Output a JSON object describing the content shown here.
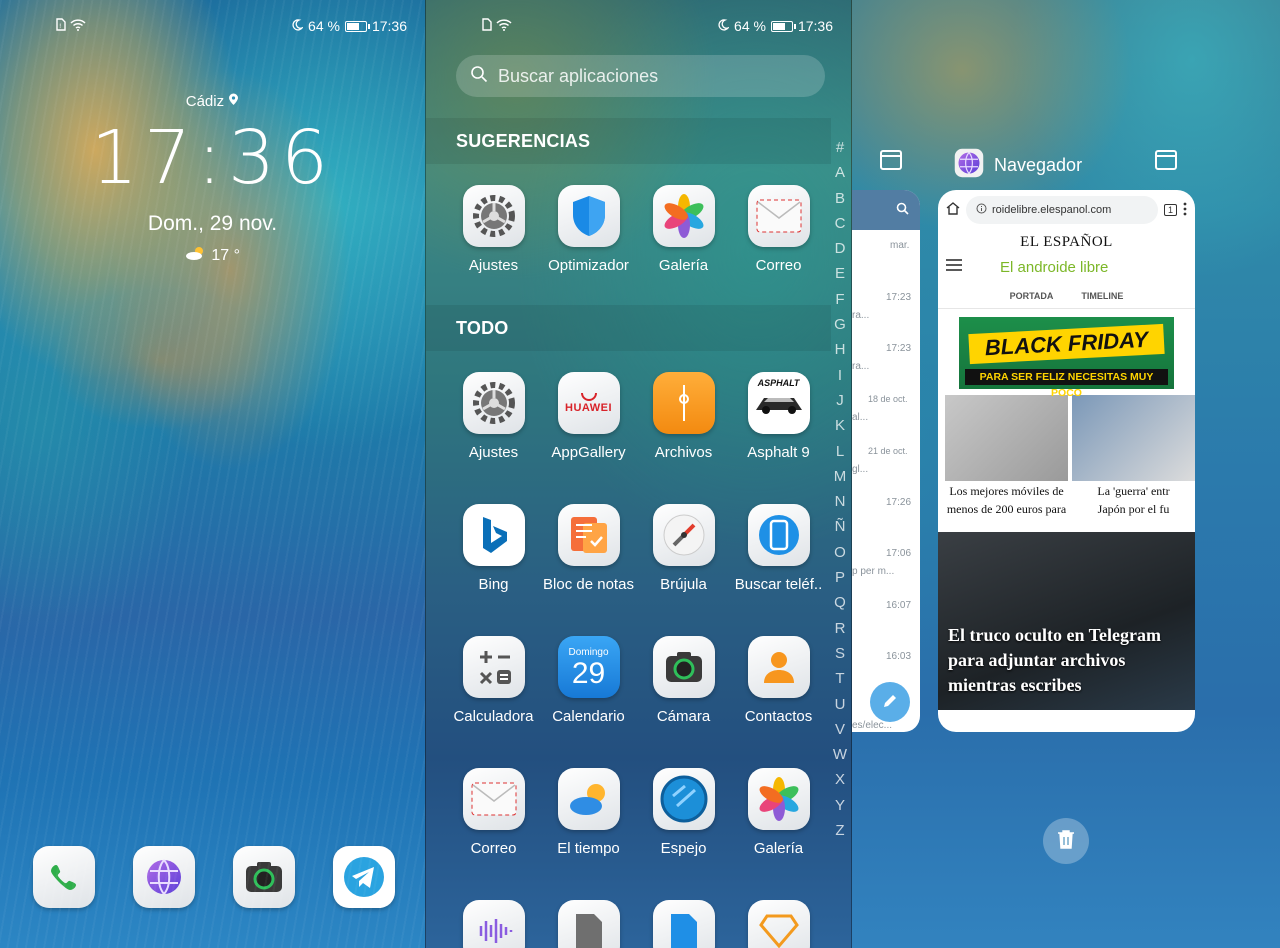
{
  "status": {
    "battery": "64 %",
    "time": "17:36"
  },
  "lockscreen": {
    "city": "Cádiz",
    "time": "17:36",
    "date": "Dom., 29 nov.",
    "temperature": "17 °",
    "dock": [
      "phone-icon",
      "browser-icon",
      "camera-icon",
      "telegram-icon"
    ]
  },
  "drawer": {
    "search_placeholder": "Buscar aplicaciones",
    "suggestions_title": "SUGERENCIAS",
    "suggestions": [
      {
        "label": "Ajustes",
        "icon": "settings-icon"
      },
      {
        "label": "Optimizador",
        "icon": "shield-icon"
      },
      {
        "label": "Galería",
        "icon": "gallery-icon"
      },
      {
        "label": "Correo",
        "icon": "mail-icon"
      }
    ],
    "all_title": "TODO",
    "apps": [
      {
        "label": "Ajustes",
        "icon": "settings-icon"
      },
      {
        "label": "AppGallery",
        "icon": "appgallery-icon",
        "text": "HUAWEI"
      },
      {
        "label": "Archivos",
        "icon": "files-icon"
      },
      {
        "label": "Asphalt 9",
        "icon": "asphalt-icon",
        "text": "ASPHALT"
      },
      {
        "label": "Bing",
        "icon": "bing-icon"
      },
      {
        "label": "Bloc de notas",
        "icon": "notes-icon"
      },
      {
        "label": "Brújula",
        "icon": "compass-icon"
      },
      {
        "label": "Buscar teléf..",
        "icon": "find-phone-icon"
      },
      {
        "label": "Calculadora",
        "icon": "calculator-icon"
      },
      {
        "label": "Calendario",
        "icon": "calendar-icon",
        "text": "Domingo",
        "day": "29"
      },
      {
        "label": "Cámara",
        "icon": "camera-icon"
      },
      {
        "label": "Contactos",
        "icon": "contacts-icon"
      },
      {
        "label": "Correo",
        "icon": "mail-icon"
      },
      {
        "label": "El tiempo",
        "icon": "weather-icon"
      },
      {
        "label": "Espejo",
        "icon": "mirror-icon"
      },
      {
        "label": "Galería",
        "icon": "gallery-icon"
      }
    ],
    "alphabet": [
      "#",
      "A",
      "B",
      "C",
      "D",
      "E",
      "F",
      "G",
      "H",
      "I",
      "J",
      "K",
      "L",
      "M",
      "N",
      "Ñ",
      "O",
      "P",
      "Q",
      "R",
      "S",
      "T",
      "U",
      "V",
      "W",
      "X",
      "Y",
      "Z"
    ]
  },
  "recents": {
    "app_name": "Navegador",
    "left_card": {
      "times": [
        "mar.",
        "17:23",
        "17:23",
        "18 de oct.",
        "21 de oct.",
        "17:26",
        "17:06",
        "16:07",
        "16:03"
      ],
      "snippets": [
        "ra...",
        "ra...",
        "al...",
        "gl...",
        "p per m...",
        "es/elec..."
      ]
    },
    "browser": {
      "url": "roidelibre.elespanol.com",
      "tab_count": "1",
      "masthead": "EL ESPAÑOL",
      "site_logo": "El androide libre",
      "tabs": [
        "PORTADA",
        "TIMELINE"
      ],
      "ad_title": "BLACK FRIDAY",
      "ad_sub": "PARA SER FELIZ NECESITAS MUY POCO",
      "news": [
        {
          "line1": "Los mejores móviles de",
          "line2": "menos de 200 euros para"
        },
        {
          "line1": "La 'guerra' entr",
          "line2": "Japón por el fu"
        }
      ],
      "hero": "El truco oculto en Telegram para adjuntar archivos mientras escribes"
    }
  },
  "colors": {
    "accent": "#2b8bd3",
    "brand_green": "#7cb728",
    "telegram": "#2aa3e0"
  }
}
